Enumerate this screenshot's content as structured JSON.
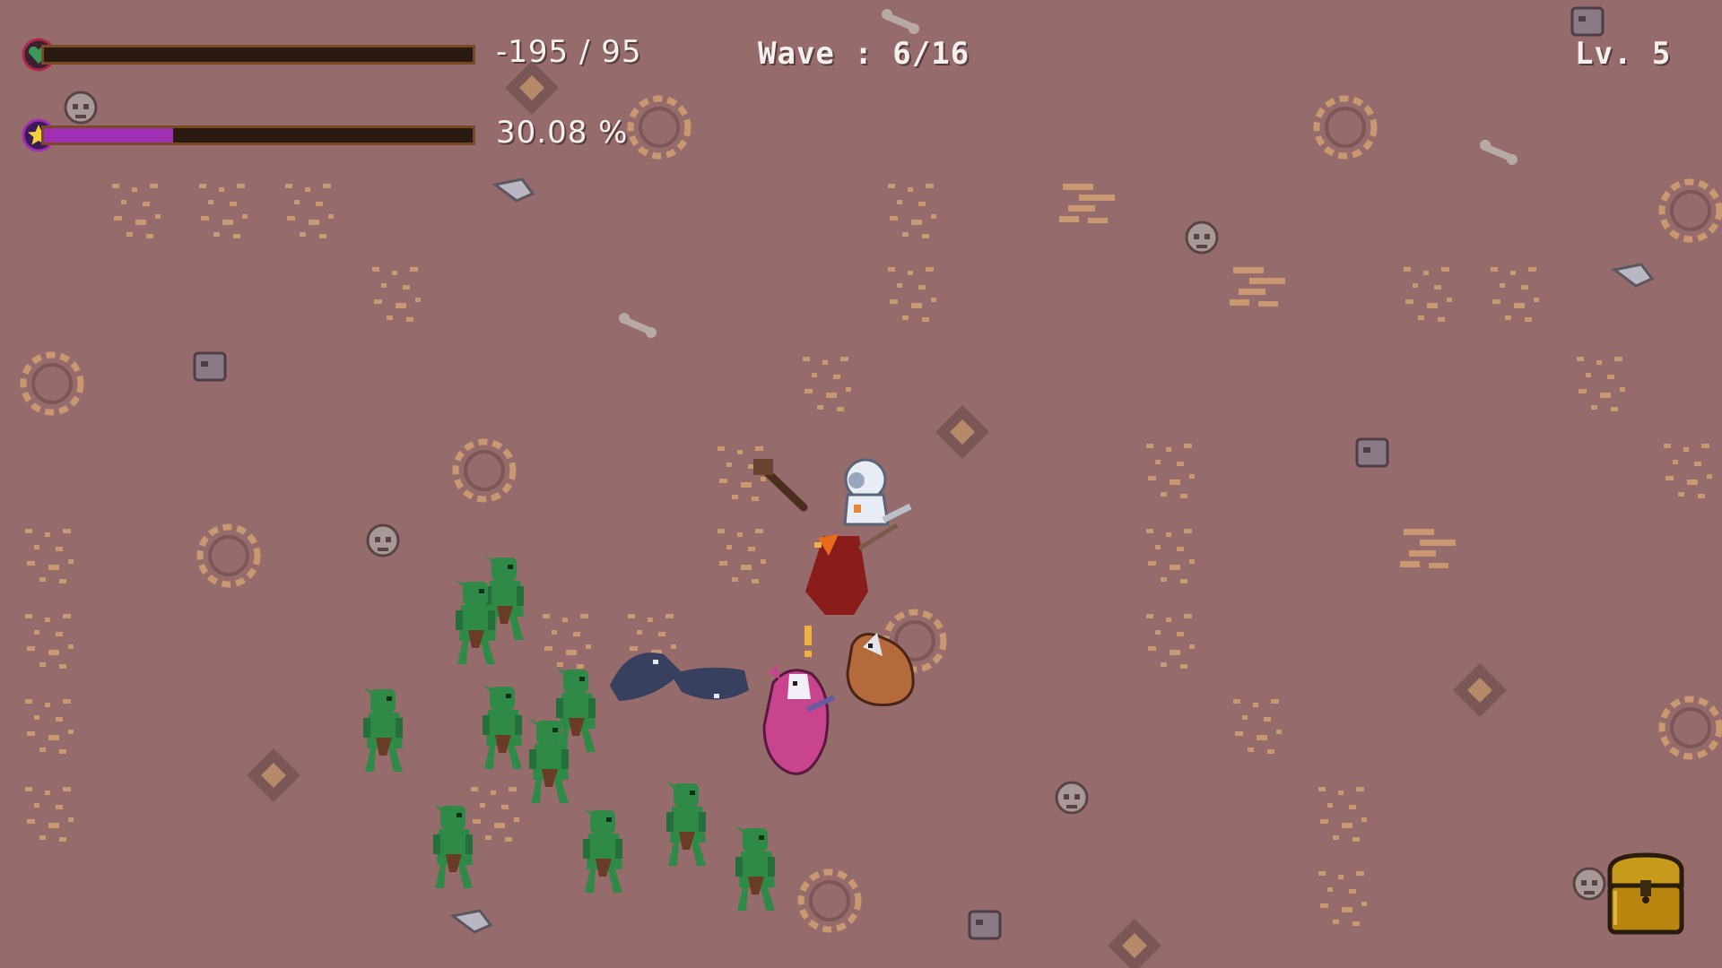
{
  "hud": {
    "health": {
      "text": "-195 / 95",
      "current": -195,
      "max": 95,
      "fill_fraction": 0,
      "color": "#2e7a46"
    },
    "experience": {
      "text": "30.08 %",
      "percent": 30.08,
      "fill_fraction": 0.3008,
      "color": "#a12fb3"
    },
    "wave": {
      "text": "Wave : 6/16"
    },
    "level": {
      "text": "Lv. 5"
    }
  },
  "icons": {
    "health": "heart-icon",
    "experience": "star-icon",
    "inventory": "treasure-chest-icon"
  },
  "colors": {
    "ground": "#966b6b",
    "ground_detail": "#c99770",
    "goblin": "#2f8a48",
    "bar_border": "#7a4a26",
    "hud_text": "#f4f0f0"
  }
}
